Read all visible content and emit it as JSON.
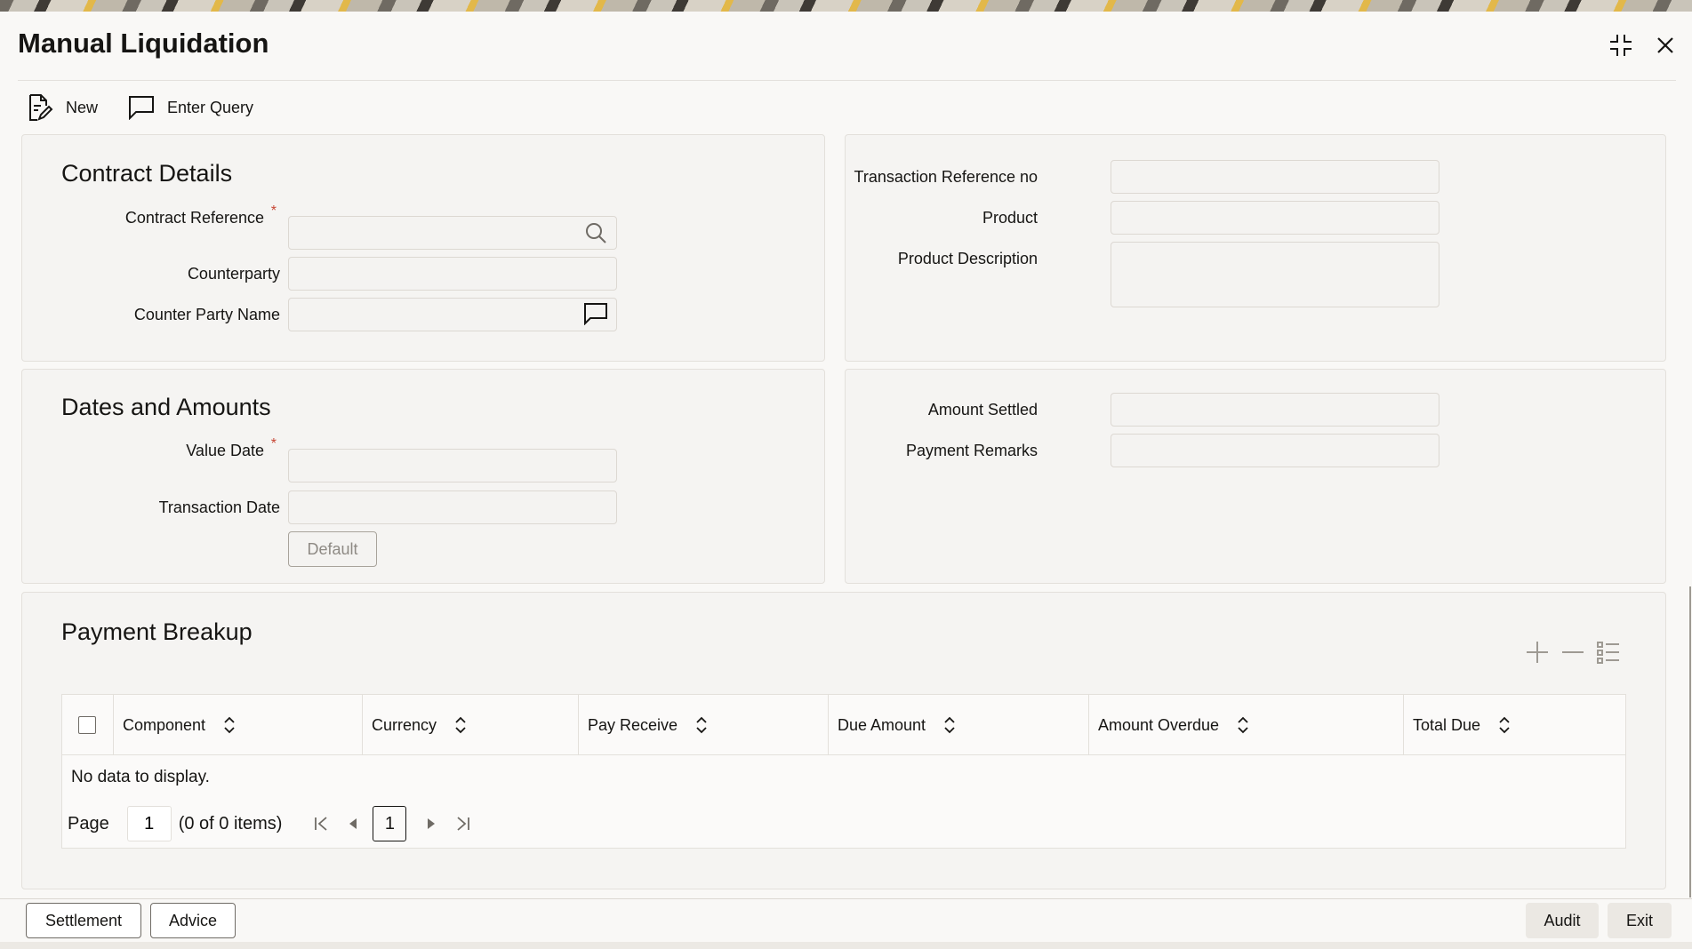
{
  "window": {
    "title": "Manual Liquidation",
    "restore_icon": "collapse-icon",
    "close_icon": "close-icon"
  },
  "toolbar": {
    "new_label": "New",
    "enter_query_label": "Enter Query"
  },
  "contract_details": {
    "title": "Contract Details",
    "contract_reference_label": "Contract Reference",
    "contract_reference_value": "",
    "counterparty_label": "Counterparty",
    "counterparty_value": "",
    "counter_party_name_label": "Counter Party Name",
    "counter_party_name_value": ""
  },
  "transaction_info": {
    "transaction_reference_no_label": "Transaction Reference no",
    "transaction_reference_no_value": "",
    "product_label": "Product",
    "product_value": "",
    "product_description_label": "Product Description",
    "product_description_value": ""
  },
  "dates_amounts": {
    "title": "Dates and Amounts",
    "value_date_label": "Value Date",
    "value_date_value": "",
    "transaction_date_label": "Transaction Date",
    "transaction_date_value": "",
    "default_button": "Default"
  },
  "settlement_info": {
    "amount_settled_label": "Amount Settled",
    "amount_settled_value": "",
    "payment_remarks_label": "Payment Remarks",
    "payment_remarks_value": ""
  },
  "payment_breakup": {
    "title": "Payment Breakup",
    "columns": [
      "Component",
      "Currency",
      "Pay Receive",
      "Due Amount",
      "Amount Overdue",
      "Total Due"
    ],
    "no_data": "No data to display.",
    "pager": {
      "page_label": "Page",
      "page_value": "1",
      "items_text": "(0 of 0 items)",
      "current_page": "1"
    }
  },
  "footer": {
    "settlement_label": "Settlement",
    "advice_label": "Advice",
    "audit_label": "Audit",
    "exit_label": "Exit"
  },
  "colors": {
    "required": "#c74634",
    "text": "#161513",
    "panel": "#f5f4f2"
  }
}
